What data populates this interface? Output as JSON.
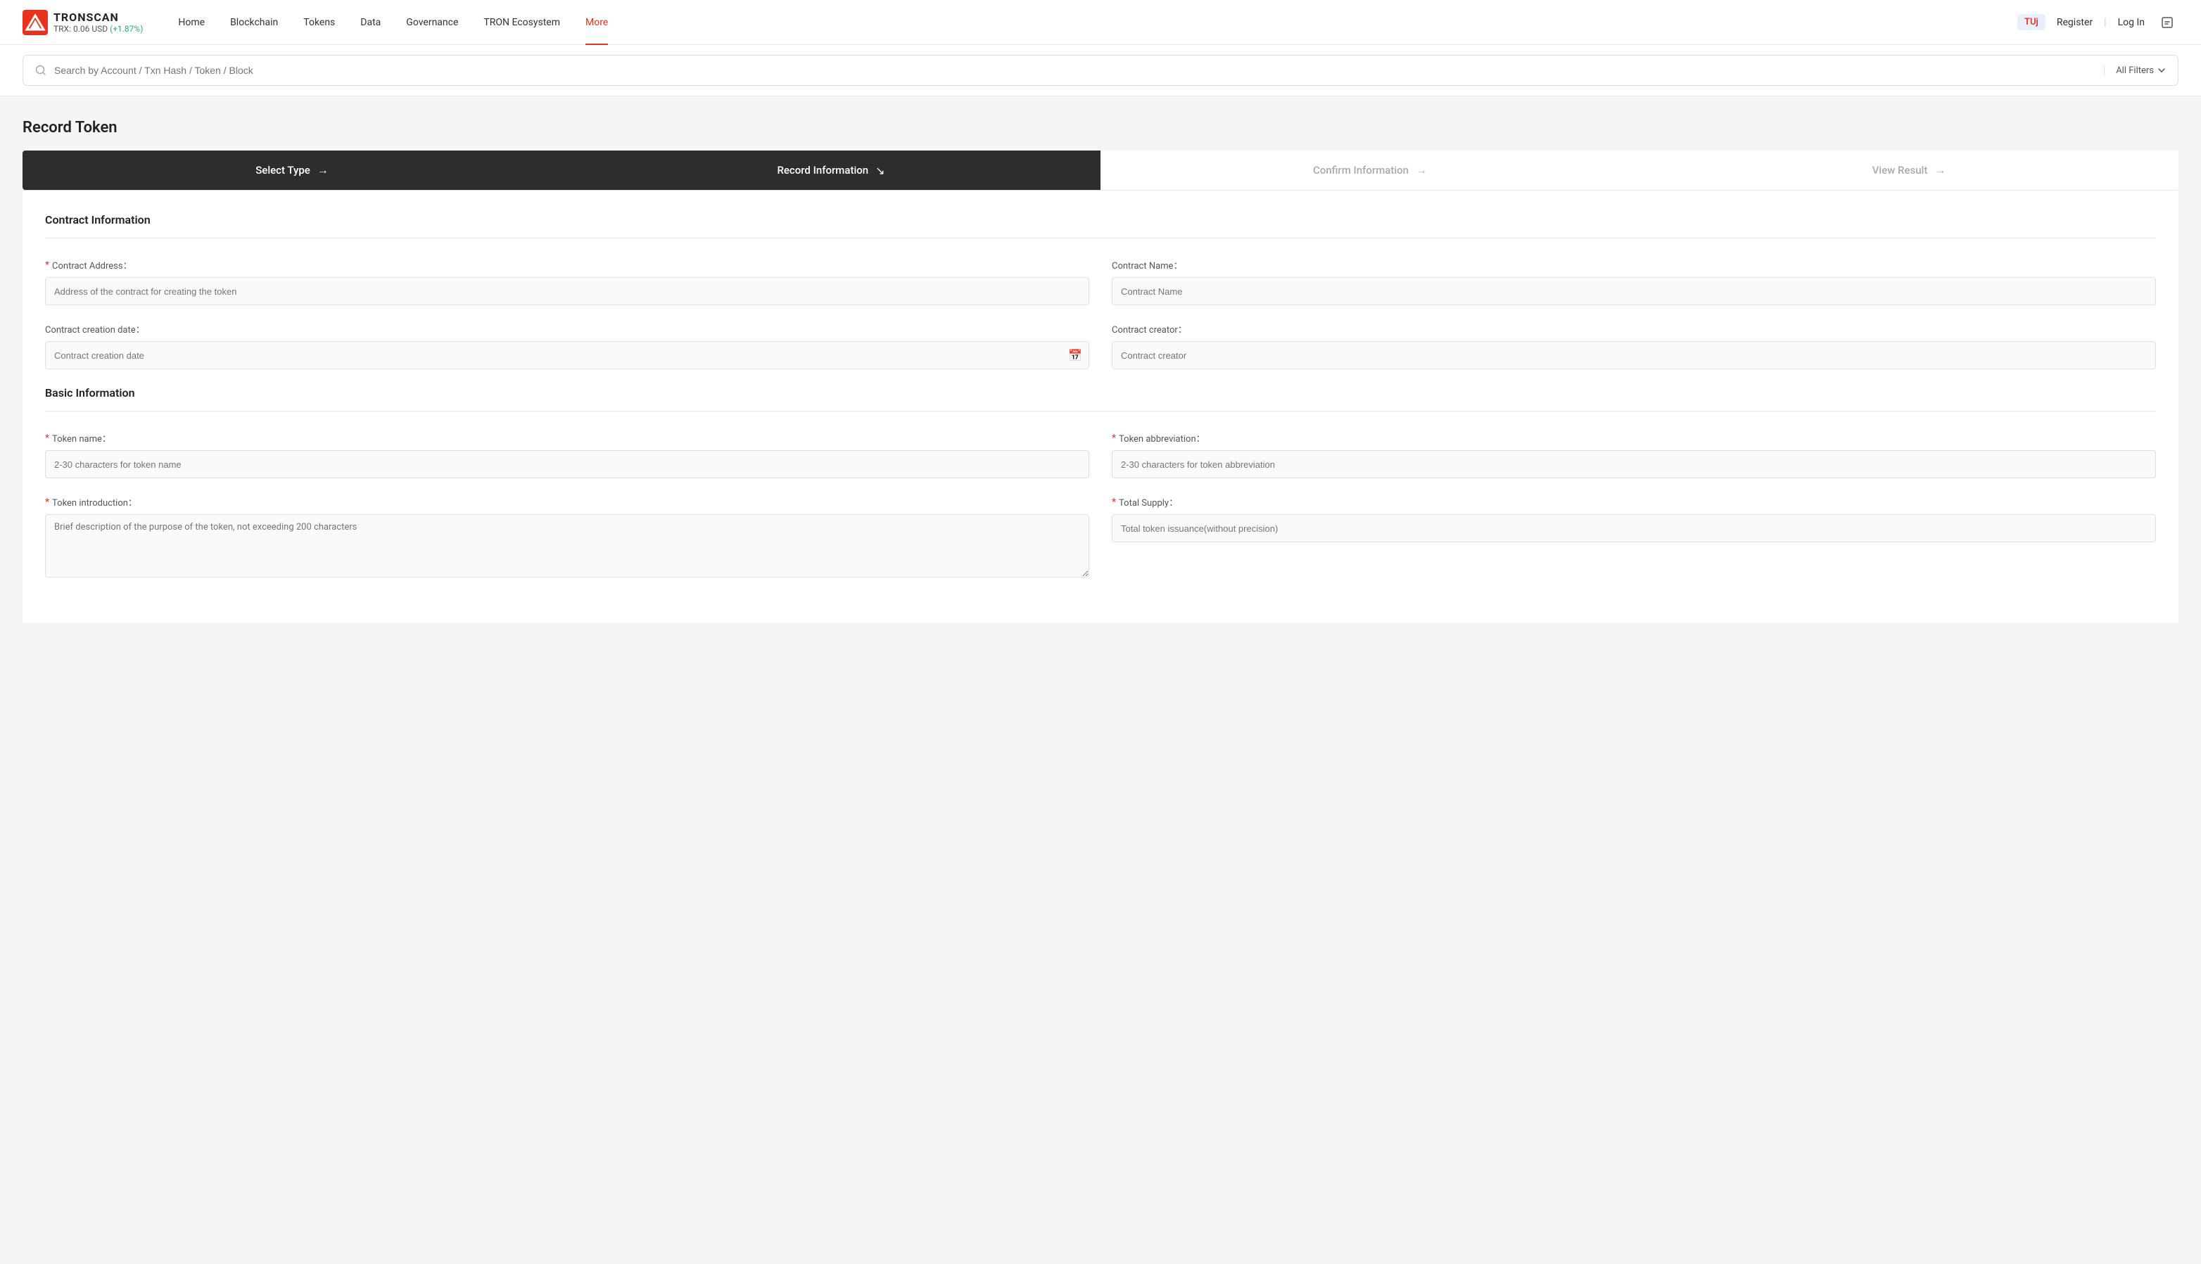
{
  "navbar": {
    "logo_text": "TRONSCAN",
    "trx_price": "TRX: 0.06 USD",
    "trx_change": "(+1.87%)",
    "nav_items": [
      {
        "label": "Home",
        "active": false
      },
      {
        "label": "Blockchain",
        "active": false
      },
      {
        "label": "Tokens",
        "active": false
      },
      {
        "label": "Data",
        "active": false
      },
      {
        "label": "Governance",
        "active": false
      },
      {
        "label": "TRON Ecosystem",
        "active": false
      },
      {
        "label": "More",
        "active": true
      }
    ],
    "user_badge": "TUj",
    "register_label": "Register",
    "login_label": "Log In"
  },
  "search": {
    "placeholder": "Search by Account / Txn Hash / Token / Block",
    "filters_label": "All Filters"
  },
  "page": {
    "title": "Record Token"
  },
  "steps": [
    {
      "label": "Select Type",
      "arrow": "→",
      "state": "active"
    },
    {
      "label": "Record Information",
      "arrow": "↘",
      "state": "active"
    },
    {
      "label": "Confirm Information",
      "arrow": "→",
      "state": "inactive"
    },
    {
      "label": "View Result",
      "arrow": "→",
      "state": "inactive"
    }
  ],
  "contract_section": {
    "title": "Contract Information",
    "fields": {
      "contract_address": {
        "label": "Contract Address：",
        "required": true,
        "placeholder": "Address of the contract for creating the token"
      },
      "contract_name": {
        "label": "Contract Name：",
        "required": false,
        "placeholder": "Contract Name"
      },
      "contract_creation_date": {
        "label": "Contract creation date：",
        "required": false,
        "placeholder": "Contract creation date"
      },
      "contract_creator": {
        "label": "Contract creator：",
        "required": false,
        "placeholder": "Contract creator"
      }
    }
  },
  "basic_section": {
    "title": "Basic Information",
    "fields": {
      "token_name": {
        "label": "Token name：",
        "required": true,
        "placeholder": "2-30 characters for token name"
      },
      "token_abbreviation": {
        "label": "Token abbreviation：",
        "required": true,
        "placeholder": "2-30 characters for token abbreviation"
      },
      "token_introduction": {
        "label": "Token introduction：",
        "required": true,
        "placeholder": "Brief description of the purpose of the token, not exceeding 200 characters"
      },
      "total_supply": {
        "label": "Total Supply：",
        "required": true,
        "placeholder": "Total token issuance(without precision)"
      }
    }
  }
}
